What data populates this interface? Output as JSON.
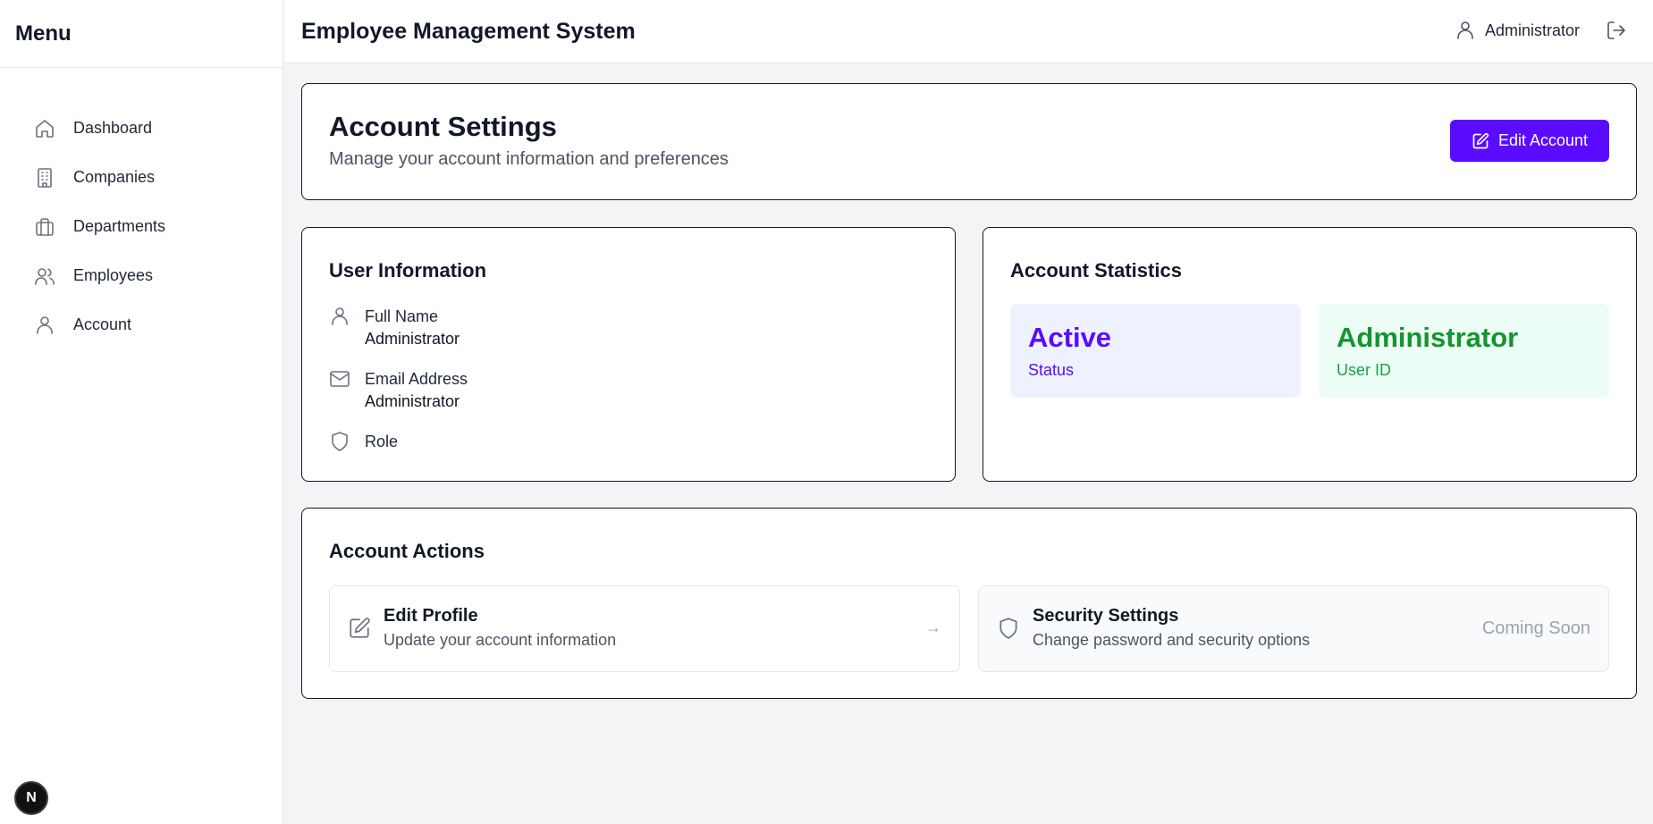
{
  "sidebar": {
    "title": "Menu",
    "items": [
      {
        "label": "Dashboard",
        "icon": "home-icon"
      },
      {
        "label": "Companies",
        "icon": "building-icon"
      },
      {
        "label": "Departments",
        "icon": "briefcase-icon"
      },
      {
        "label": "Employees",
        "icon": "users-icon"
      },
      {
        "label": "Account",
        "icon": "user-icon"
      }
    ],
    "badge": "N"
  },
  "topbar": {
    "title": "Employee Management System",
    "user": "Administrator"
  },
  "header": {
    "title": "Account Settings",
    "subtitle": "Manage your account information and preferences",
    "edit_button": "Edit Account"
  },
  "user_info": {
    "title": "User Information",
    "full_name_label": "Full Name",
    "full_name_value": "Administrator",
    "email_label": "Email Address",
    "email_value": "Administrator",
    "role_label": "Role"
  },
  "stats": {
    "title": "Account Statistics",
    "status_value": "Active",
    "status_label": "Status",
    "userid_value": "Administrator",
    "userid_label": "User ID"
  },
  "actions": {
    "title": "Account Actions",
    "edit_profile_title": "Edit Profile",
    "edit_profile_desc": "Update your account information",
    "edit_profile_arrow": "→",
    "security_title": "Security Settings",
    "security_desc": "Change password and security options",
    "security_status": "Coming Soon"
  },
  "colors": {
    "accent": "#5b0bff",
    "success": "#15952e",
    "background": "#f3f4f6"
  }
}
